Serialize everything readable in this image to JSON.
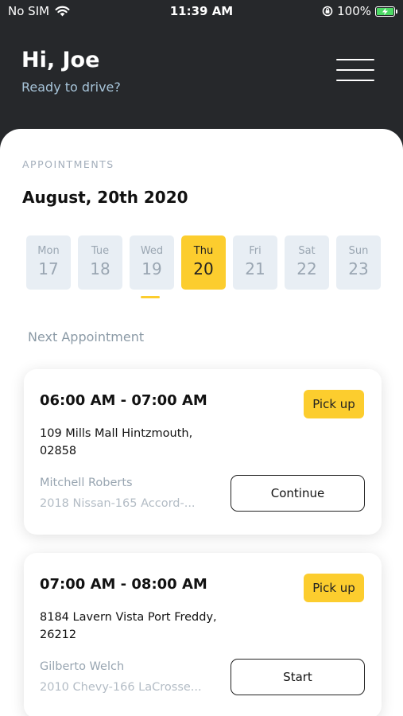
{
  "status_bar": {
    "carrier": "No SIM",
    "time": "11:39 AM",
    "battery": "100%"
  },
  "header": {
    "greeting": "Hi, Joe",
    "subtitle": "Ready to drive?"
  },
  "appointments": {
    "section_label": "APPOINTMENTS",
    "date_title": "August, 20th 2020",
    "days": [
      {
        "name": "Mon",
        "num": "17"
      },
      {
        "name": "Tue",
        "num": "18"
      },
      {
        "name": "Wed",
        "num": "19"
      },
      {
        "name": "Thu",
        "num": "20"
      },
      {
        "name": "Fri",
        "num": "21"
      },
      {
        "name": "Sat",
        "num": "22"
      },
      {
        "name": "Sun",
        "num": "23"
      }
    ],
    "selected_day": "Thu",
    "next_label": "Next Appointment",
    "items": [
      {
        "time": "06:00 AM - 07:00 AM",
        "badge": "Pick up",
        "address_line1": "109 Mills Mall Hintzmouth,",
        "address_line2": "02858",
        "customer": "Mitchell Roberts",
        "vehicle": "2018 Nissan-165 Accord-...",
        "action": "Continue"
      },
      {
        "time": "07:00 AM - 08:00 AM",
        "badge": "Pick up",
        "address_line1": "8184 Lavern Vista Port Freddy,",
        "address_line2": "26212",
        "customer": "Gilberto Welch",
        "vehicle": "2010 Chevy-166 LaCrosse...",
        "action": "Start"
      }
    ]
  },
  "colors": {
    "header_bg": "#26282b",
    "accent": "#fccd2e",
    "day_bg": "#e8eef4",
    "muted_text": "#98a5b1",
    "subtitle_text": "#a7c4d9"
  },
  "icons": {
    "wifi": "wifi-icon",
    "orientation_lock": "orientation-lock-icon",
    "battery": "battery-charging-icon",
    "menu": "hamburger-menu-icon"
  }
}
